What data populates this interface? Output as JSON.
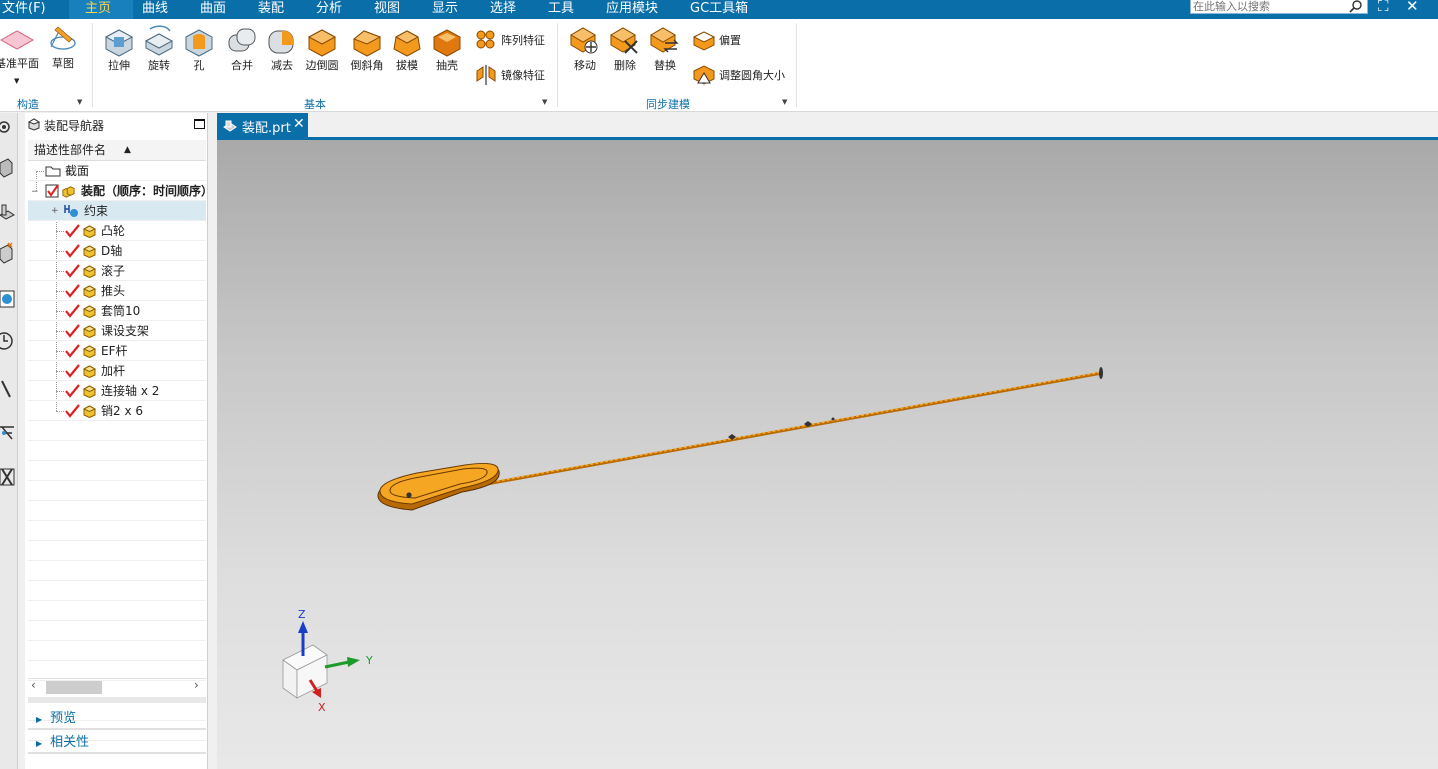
{
  "menubar": {
    "items": [
      "文件(F)",
      "主页",
      "曲线",
      "曲面",
      "装配",
      "分析",
      "视图",
      "显示",
      "选择",
      "工具",
      "应用模块",
      "GC工具箱"
    ],
    "active": "主页",
    "search_placeholder": "在此输入以搜索"
  },
  "ribbon": {
    "construct": {
      "datum_plane": "基准平面",
      "sketch": "草图",
      "group_label": "构造"
    },
    "basic": {
      "extrude": "拉伸",
      "revolve": "旋转",
      "hole": "孔",
      "unite": "合并",
      "subtract": "减去",
      "edge_blend": "边倒圆",
      "chamfer": "倒斜角",
      "draft": "拔模",
      "shell": "抽壳",
      "pattern_feature": "阵列特征",
      "mirror_feature": "镜像特征",
      "group_label": "基本"
    },
    "sync": {
      "move": "移动",
      "delete": "删除",
      "replace": "替换",
      "offset": "偏置",
      "resize_blend": "调整圆角大小",
      "group_label": "同步建模"
    }
  },
  "navigator": {
    "title": "装配导航器",
    "column_header": "描述性部件名",
    "sections_label": "截面",
    "root_label": "装配（顺序：时间顺序）",
    "constraints_label": "约束",
    "parts": [
      "凸轮",
      "D轴",
      "滚子",
      "推头",
      "套筒10",
      "课设支架",
      "EF杆",
      "加杆",
      "连接轴 x 2",
      "销2 x 6"
    ],
    "preview_label": "预览",
    "dependencies_label": "相关性"
  },
  "document_tab": {
    "label": "装配.prt",
    "close": "✕"
  },
  "triad": {
    "x": "X",
    "y": "Y",
    "z": "Z"
  },
  "colors": {
    "menubar": "#0a6ea8",
    "accent": "#ffd34d",
    "part_orange": "#f39a1c",
    "check_red": "#e02020"
  }
}
